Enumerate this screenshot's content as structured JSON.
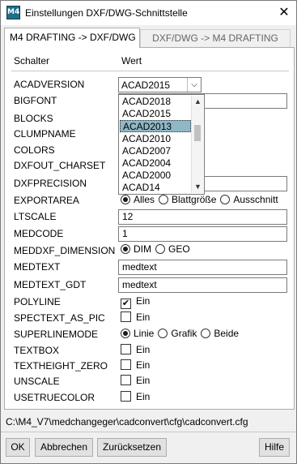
{
  "window": {
    "title": "Einstellungen DXF/DWG-Schnittstelle",
    "icon_label": "M4",
    "close_label": "✕"
  },
  "tabs": [
    {
      "label": "M4 DRAFTING -> DXF/DWG",
      "active": true
    },
    {
      "label": "DXF/DWG -> M4 DRAFTING",
      "active": false
    }
  ],
  "headers": {
    "switch": "Schalter",
    "value": "Wert"
  },
  "rows": [
    {
      "label": "ACADVERSION",
      "type": "combo",
      "value": "ACAD2015"
    },
    {
      "label": "BIGFONT",
      "type": "text",
      "value": ""
    },
    {
      "label": "BLOCKS",
      "type": "hidden"
    },
    {
      "label": "CLUMPNAME",
      "type": "hidden"
    },
    {
      "label": "COLORS",
      "type": "hidden"
    },
    {
      "label": "DXFOUT_CHARSET",
      "type": "hidden"
    },
    {
      "label": "DXFPRECISION",
      "type": "text",
      "value": ""
    },
    {
      "label": "EXPORTAREA",
      "type": "radio",
      "options": [
        "Alles",
        "Blattgröße",
        "Ausschnitt"
      ],
      "selected": 0
    },
    {
      "label": "LTSCALE",
      "type": "text",
      "value": "12"
    },
    {
      "label": "MEDCODE",
      "type": "text",
      "value": "1"
    },
    {
      "label": "MEDDXF_DIMENSION",
      "type": "radio",
      "options": [
        "DIM",
        "GEO"
      ],
      "selected": 0
    },
    {
      "label": "MEDTEXT",
      "type": "text",
      "value": "medtext"
    },
    {
      "label": "MEDTEXT_GDT",
      "type": "text",
      "value": "medtext"
    },
    {
      "label": "POLYLINE",
      "type": "check",
      "checked": true,
      "text": "Ein"
    },
    {
      "label": "SPECTEXT_AS_PIC",
      "type": "check",
      "checked": false,
      "text": "Ein"
    },
    {
      "label": "SUPERLINEMODE",
      "type": "radio",
      "options": [
        "Linie",
        "Grafik",
        "Beide"
      ],
      "selected": 0
    },
    {
      "label": "TEXTBOX",
      "type": "check",
      "checked": false,
      "text": "Ein"
    },
    {
      "label": "TEXTHEIGHT_ZERO",
      "type": "check",
      "checked": false,
      "text": "Ein"
    },
    {
      "label": "UNSCALE",
      "type": "check",
      "checked": false,
      "text": "Ein"
    },
    {
      "label": "USETRUECOLOR",
      "type": "check",
      "checked": false,
      "text": "Ein"
    }
  ],
  "dropdown": {
    "items": [
      "ACAD2018",
      "ACAD2015",
      "ACAD2013",
      "ACAD2010",
      "ACAD2007",
      "ACAD2004",
      "ACAD2000",
      "ACAD14"
    ],
    "highlighted": "ACAD2013"
  },
  "path": "C:\\M4_V7\\medchangeger\\cadconvert\\cfg\\cadconvert.cfg",
  "buttons": {
    "ok": "OK",
    "cancel": "Abbrechen",
    "reset": "Zurücksetzen",
    "help": "Hilfe"
  },
  "colors": {
    "selection": "#8fb8c6",
    "app_icon": "#1f6f87"
  }
}
